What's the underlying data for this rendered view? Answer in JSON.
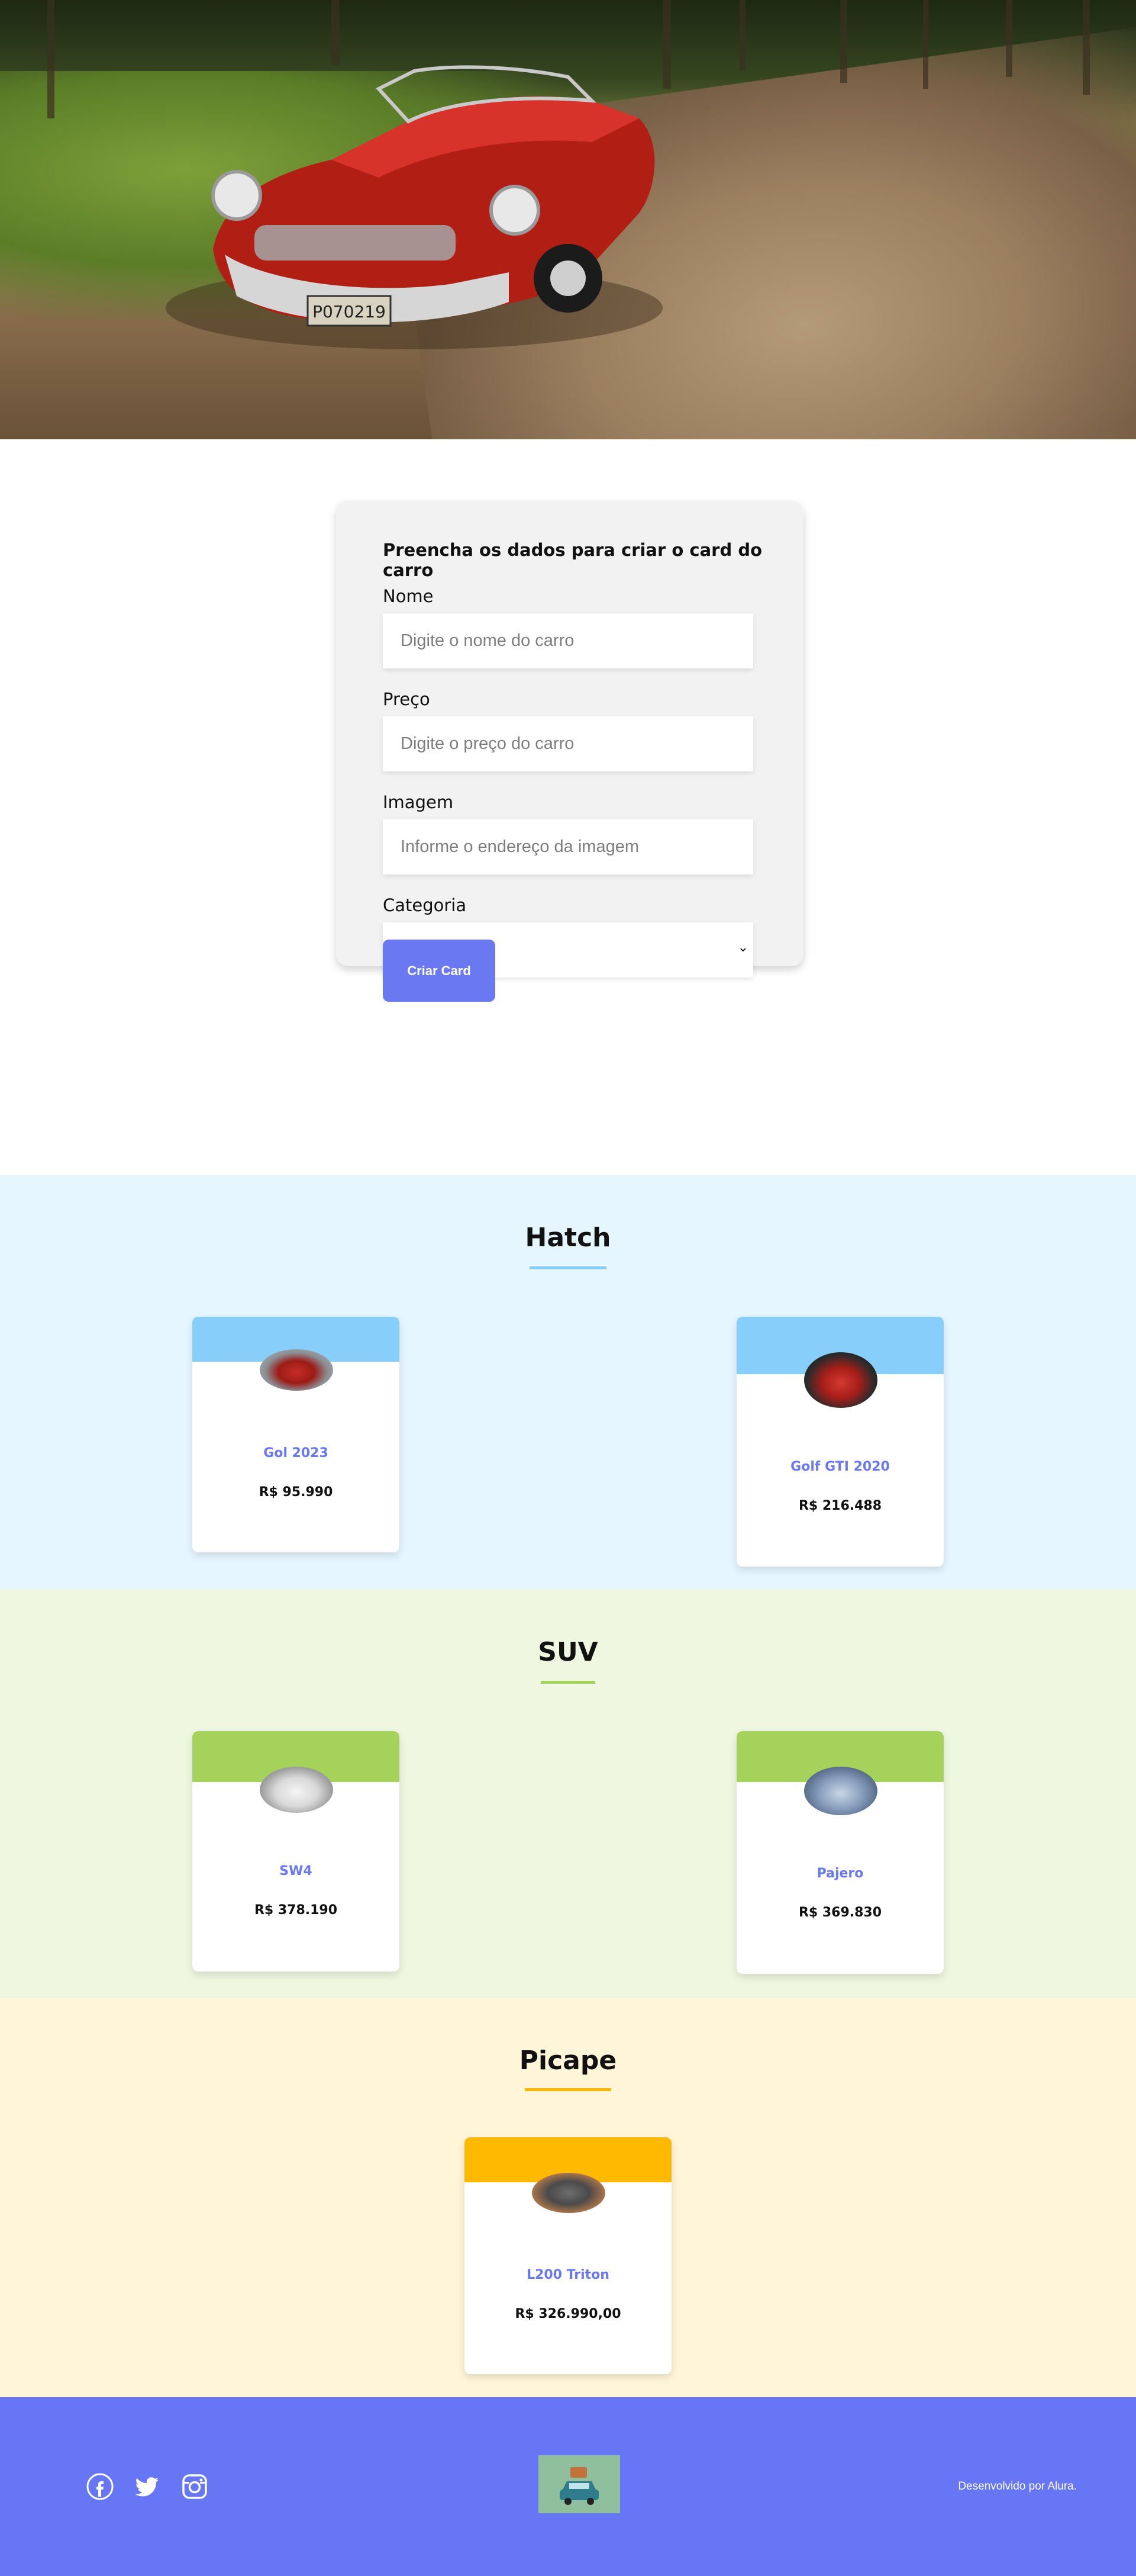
{
  "form": {
    "title": "Preencha os dados para criar o card do carro",
    "name_label": "Nome",
    "name_placeholder": "Digite o nome do carro",
    "price_label": "Preço",
    "price_placeholder": "Digite o preço do carro",
    "image_label": "Imagem",
    "image_placeholder": "Informe o endereço da imagem",
    "category_label": "Categoria",
    "category_value": "",
    "submit_label": "Criar Card"
  },
  "categories": [
    {
      "title": "Hatch",
      "accent": "#87cefa",
      "cars": [
        {
          "name": "Gol 2023",
          "price": "R$ 95.990"
        },
        {
          "name": "Golf GTI 2020",
          "price": "R$ 216.488"
        }
      ]
    },
    {
      "title": "SUV",
      "accent": "#a5d25a",
      "cars": [
        {
          "name": "SW4",
          "price": "R$ 378.190"
        },
        {
          "name": "Pajero",
          "price": "R$ 369.830"
        }
      ]
    },
    {
      "title": "Picape",
      "accent": "#ffb900",
      "cars": [
        {
          "name": "L200 Triton",
          "price": "R$ 326.990,00"
        }
      ]
    }
  ],
  "footer": {
    "credit": "Desenvolvido por Alura.",
    "social_icons": [
      "facebook-icon",
      "twitter-icon",
      "instagram-icon"
    ],
    "background": "#6776f5"
  },
  "colors": {
    "button": "#6a78f2",
    "card_name": "#6a78f2"
  }
}
